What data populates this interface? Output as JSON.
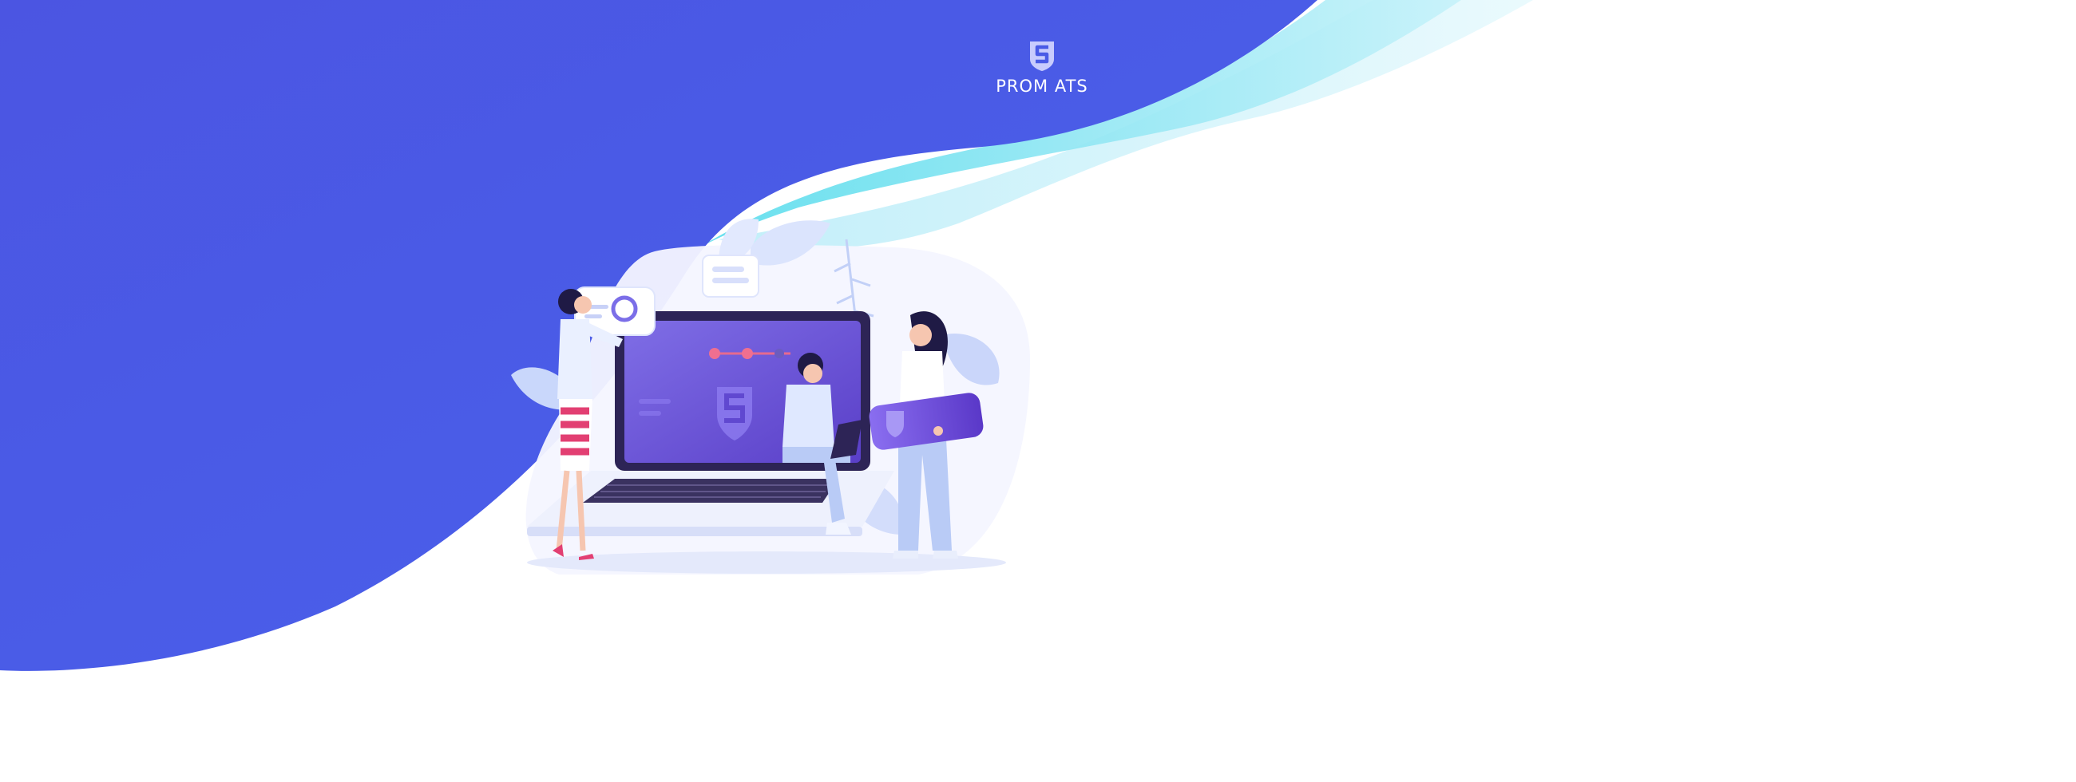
{
  "brand": {
    "name": "PROM ATS",
    "logo_icon": "shield-s-logo-icon"
  },
  "colors": {
    "primary_blue": "#4a5be6",
    "teal_wave": "#5fdcec",
    "light_wave": "#c3f0fa",
    "background": "#ffffff",
    "screen_purple": "#6b52d6"
  },
  "illustration": {
    "icon": "team-working-laptop-illustration"
  }
}
